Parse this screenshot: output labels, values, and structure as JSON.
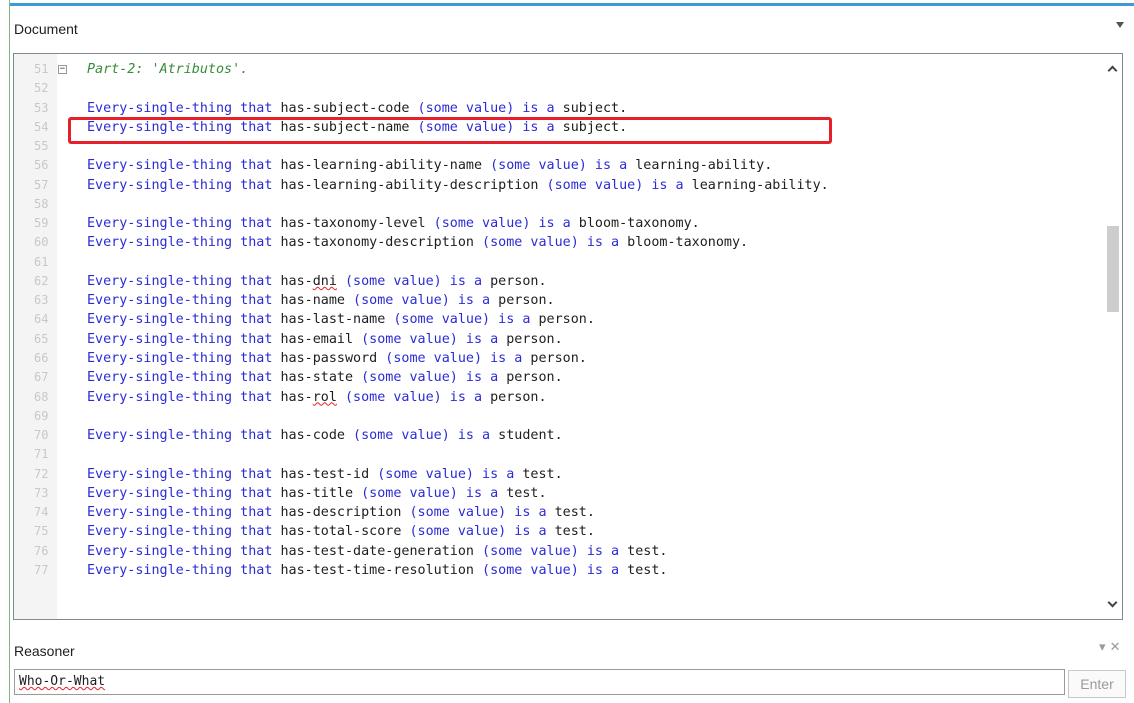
{
  "document_panel": {
    "title": "Document"
  },
  "editor": {
    "lines": [
      {
        "num": "51",
        "parts": [
          [
            "cm",
            "Part-2: 'Atributos'."
          ]
        ],
        "fold": true
      },
      {
        "num": "52",
        "parts": []
      },
      {
        "num": "53",
        "parts": [
          [
            "kw",
            "Every-single-thing that "
          ],
          [
            "tx",
            "has-subject-code "
          ],
          [
            "kw",
            "(some value) is a "
          ],
          [
            "tx",
            "subject."
          ]
        ]
      },
      {
        "num": "54",
        "parts": [
          [
            "kw",
            "Every-single-thing that "
          ],
          [
            "tx",
            "has-subject-name "
          ],
          [
            "kw",
            "(some value) is a "
          ],
          [
            "tx",
            "subject."
          ]
        ]
      },
      {
        "num": "55",
        "parts": []
      },
      {
        "num": "56",
        "parts": [
          [
            "kw",
            "Every-single-thing that "
          ],
          [
            "tx",
            "has-learning-ability-name "
          ],
          [
            "kw",
            "(some value) is a "
          ],
          [
            "tx",
            "learning-ability."
          ]
        ]
      },
      {
        "num": "57",
        "parts": [
          [
            "kw",
            "Every-single-thing that "
          ],
          [
            "tx",
            "has-learning-ability-description "
          ],
          [
            "kw",
            "(some value) is a "
          ],
          [
            "tx",
            "learning-ability."
          ]
        ]
      },
      {
        "num": "58",
        "parts": []
      },
      {
        "num": "59",
        "parts": [
          [
            "kw",
            "Every-single-thing that "
          ],
          [
            "tx",
            "has-taxonomy-level "
          ],
          [
            "kw",
            "(some value) is a "
          ],
          [
            "tx",
            "bloom-taxonomy."
          ]
        ]
      },
      {
        "num": "60",
        "parts": [
          [
            "kw",
            "Every-single-thing that "
          ],
          [
            "tx",
            "has-taxonomy-description "
          ],
          [
            "kw",
            "(some value) is a "
          ],
          [
            "tx",
            "bloom-taxonomy."
          ]
        ]
      },
      {
        "num": "61",
        "parts": []
      },
      {
        "num": "62",
        "parts": [
          [
            "kw",
            "Every-single-thing that "
          ],
          [
            "tx",
            "has-"
          ],
          [
            "sq",
            "dni"
          ],
          [
            "tx",
            " "
          ],
          [
            "kw",
            "(some value) is a "
          ],
          [
            "tx",
            "person."
          ]
        ]
      },
      {
        "num": "63",
        "parts": [
          [
            "kw",
            "Every-single-thing that "
          ],
          [
            "tx",
            "has-name "
          ],
          [
            "kw",
            "(some value) is a "
          ],
          [
            "tx",
            "person."
          ]
        ]
      },
      {
        "num": "64",
        "parts": [
          [
            "kw",
            "Every-single-thing that "
          ],
          [
            "tx",
            "has-last-name "
          ],
          [
            "kw",
            "(some value) is a "
          ],
          [
            "tx",
            "person."
          ]
        ]
      },
      {
        "num": "65",
        "parts": [
          [
            "kw",
            "Every-single-thing that "
          ],
          [
            "tx",
            "has-email "
          ],
          [
            "kw",
            "(some value) is a "
          ],
          [
            "tx",
            "person."
          ]
        ]
      },
      {
        "num": "66",
        "parts": [
          [
            "kw",
            "Every-single-thing that "
          ],
          [
            "tx",
            "has-password "
          ],
          [
            "kw",
            "(some value) is a "
          ],
          [
            "tx",
            "person."
          ]
        ]
      },
      {
        "num": "67",
        "parts": [
          [
            "kw",
            "Every-single-thing that "
          ],
          [
            "tx",
            "has-state "
          ],
          [
            "kw",
            "(some value) is a "
          ],
          [
            "tx",
            "person."
          ]
        ]
      },
      {
        "num": "68",
        "parts": [
          [
            "kw",
            "Every-single-thing that "
          ],
          [
            "tx",
            "has-"
          ],
          [
            "sq",
            "rol"
          ],
          [
            "tx",
            " "
          ],
          [
            "kw",
            "(some value) is a "
          ],
          [
            "tx",
            "person."
          ]
        ]
      },
      {
        "num": "69",
        "parts": []
      },
      {
        "num": "70",
        "parts": [
          [
            "kw",
            "Every-single-thing that "
          ],
          [
            "tx",
            "has-code "
          ],
          [
            "kw",
            "(some value) is a "
          ],
          [
            "tx",
            "student."
          ]
        ]
      },
      {
        "num": "71",
        "parts": []
      },
      {
        "num": "72",
        "parts": [
          [
            "kw",
            "Every-single-thing that "
          ],
          [
            "tx",
            "has-test-id "
          ],
          [
            "kw",
            "(some value) is a "
          ],
          [
            "tx",
            "test."
          ]
        ]
      },
      {
        "num": "73",
        "parts": [
          [
            "kw",
            "Every-single-thing that "
          ],
          [
            "tx",
            "has-title "
          ],
          [
            "kw",
            "(some value) is a "
          ],
          [
            "tx",
            "test."
          ]
        ]
      },
      {
        "num": "74",
        "parts": [
          [
            "kw",
            "Every-single-thing that "
          ],
          [
            "tx",
            "has-description "
          ],
          [
            "kw",
            "(some value) is a "
          ],
          [
            "tx",
            "test."
          ]
        ]
      },
      {
        "num": "75",
        "parts": [
          [
            "kw",
            "Every-single-thing that "
          ],
          [
            "tx",
            "has-total-score "
          ],
          [
            "kw",
            "(some value) is a "
          ],
          [
            "tx",
            "test."
          ]
        ]
      },
      {
        "num": "76",
        "parts": [
          [
            "kw",
            "Every-single-thing that "
          ],
          [
            "tx",
            "has-test-date-generation "
          ],
          [
            "kw",
            "(some value) is a "
          ],
          [
            "tx",
            "test."
          ]
        ]
      },
      {
        "num": "77",
        "parts": [
          [
            "kw",
            "Every-single-thing that "
          ],
          [
            "tx",
            "has-test-time-resolution "
          ],
          [
            "kw",
            "(some value) is a "
          ],
          [
            "tx",
            "test."
          ]
        ]
      }
    ],
    "highlight_color": "#e5202b"
  },
  "reasoner_panel": {
    "title": "Reasoner",
    "input_value": "Who-Or-What",
    "enter_label": "Enter",
    "controls": "▾ ✕"
  }
}
